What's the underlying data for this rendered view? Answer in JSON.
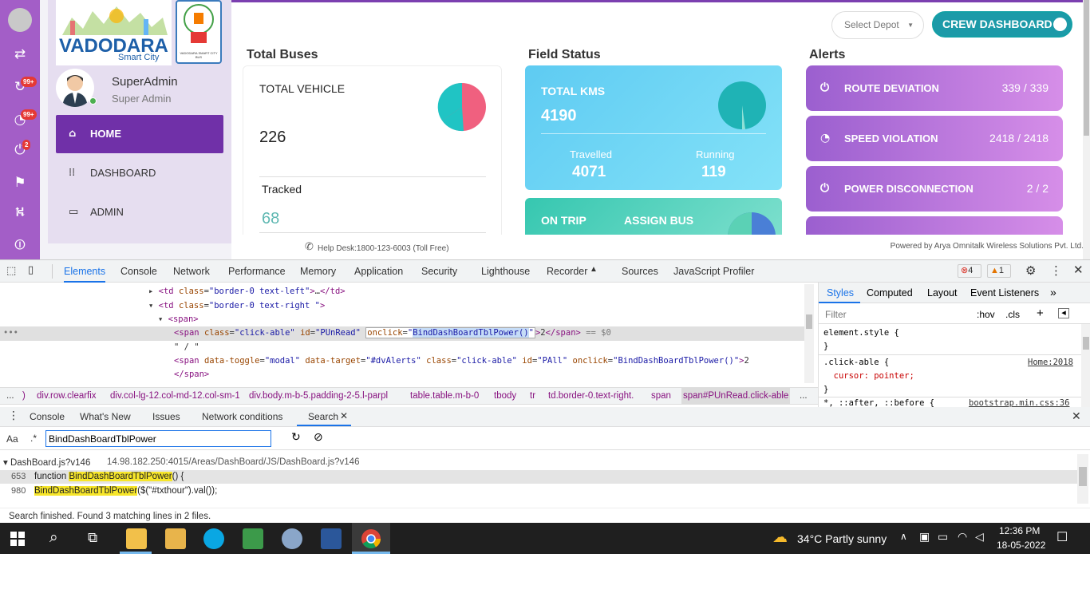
{
  "app": {
    "logo_text": "VADODARA",
    "logo_sub": "Smart City",
    "badge_sub": "VADODARA SMART CITY BUS",
    "iconbar_badges": [
      "99+",
      "99+",
      "2"
    ],
    "user": {
      "name": "SuperAdmin",
      "role": "Super Admin"
    },
    "nav": [
      {
        "label": "HOME",
        "icon": "home-icon"
      },
      {
        "label": "DASHBOARD",
        "icon": "grid-icon"
      },
      {
        "label": "ADMIN",
        "icon": "monitor-icon"
      }
    ],
    "select_depot": "Select Depot",
    "crew_dashboard": "CREW DASHBOARD",
    "sections": {
      "buses": "Total Buses",
      "field": "Field Status",
      "alerts": "Alerts"
    },
    "total_vehicle": {
      "label": "TOTAL VEHICLE",
      "value": "226",
      "tracked_label": "Tracked",
      "tracked_value": "68"
    },
    "field": {
      "total_kms_label": "TOTAL KMS",
      "total_kms": "4190",
      "travelled_label": "Travelled",
      "travelled": "4071",
      "running_label": "Running",
      "running": "119",
      "on_trip": "ON TRIP",
      "assign_bus": "ASSIGN BUS"
    },
    "alerts": [
      {
        "label": "ROUTE DEVIATION",
        "count": "339 / 339",
        "icon": "plug-icon"
      },
      {
        "label": "SPEED VIOLATION",
        "count": "2418 / 2418",
        "icon": "speedometer-icon"
      },
      {
        "label": "POWER DISCONNECTION",
        "count": "2 / 2",
        "icon": "plug-icon"
      }
    ],
    "helpdesk": "Help Desk:1800-123-6003 (Toll Free)",
    "powered_by": "Powered by Arya Omnitalk Wireless Solutions Pvt. Ltd."
  },
  "devtools": {
    "tabs": [
      "Elements",
      "Console",
      "Network",
      "Performance",
      "Memory",
      "Application",
      "Security",
      "Lighthouse",
      "Recorder",
      "Sources",
      "JavaScript Profiler"
    ],
    "error_count": "4",
    "warning_count": "1",
    "styles_tabs": [
      "Styles",
      "Computed",
      "Layout",
      "Event Listeners"
    ],
    "styles_filter": "Filter",
    "hov": ":hov",
    "cls": ".cls",
    "styles_lines": [
      "element.style {",
      "}",
      ".click-able {",
      "  cursor: pointer;",
      "}",
      "*, ::after, ::before {"
    ],
    "styles_sources": [
      "Home:2018",
      "bootstrap.min.css:36"
    ],
    "breadcrumbs": [
      "...",
      ")",
      "div.row.clearfix",
      "div.col-lg-12.col-md-12.col-sm-12",
      "div.body.m-b-5.padding-2-5.l-parpl",
      "table.table.m-b-0",
      "tbody",
      "tr",
      "td.border-0.text-right.",
      "span",
      "span#PUnRead.click-able",
      "..."
    ],
    "drawer_tabs": [
      "Console",
      "What's New",
      "Issues",
      "Network conditions",
      "Search"
    ],
    "search_query": "BindDashBoardTblPower",
    "aa": "Aa",
    "regex": ".*",
    "result_file": "DashBoard.js?v146",
    "result_url": "14.98.182.250:4015/Areas/DashBoard/JS/DashBoard.js?v146",
    "result_lines": [
      {
        "num": "653",
        "before": "function ",
        "match": "BindDashBoardTblPower",
        "after": "() {"
      },
      {
        "num": "980",
        "before": "",
        "match": "BindDashBoardTblPower",
        "after": "($(\"#txthour\").val());"
      }
    ],
    "status": "Search finished.  Found 3 matching lines in 2 files."
  },
  "taskbar": {
    "weather": "34°C  Partly sunny",
    "time": "12:36 PM",
    "date": "18-05-2022"
  }
}
